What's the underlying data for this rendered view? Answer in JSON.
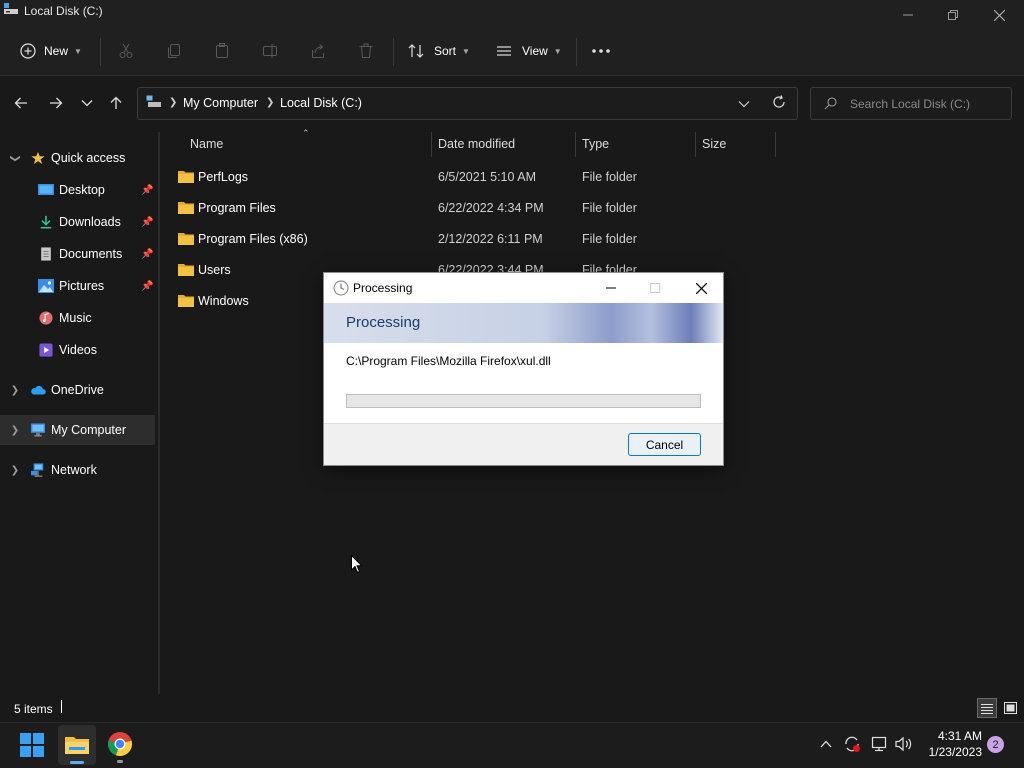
{
  "window": {
    "title": "Local Disk (C:)"
  },
  "toolbar": {
    "new_label": "New",
    "sort_label": "Sort",
    "view_label": "View"
  },
  "breadcrumb": {
    "items": [
      "My Computer",
      "Local Disk (C:)"
    ]
  },
  "search": {
    "placeholder": "Search Local Disk (C:)"
  },
  "columns": {
    "name": "Name",
    "date": "Date modified",
    "type": "Type",
    "size": "Size"
  },
  "files": [
    {
      "name": "PerfLogs",
      "date": "6/5/2021 5:10 AM",
      "type": "File folder"
    },
    {
      "name": "Program Files",
      "date": "6/22/2022 4:34 PM",
      "type": "File folder"
    },
    {
      "name": "Program Files (x86)",
      "date": "2/12/2022 6:11 PM",
      "type": "File folder"
    },
    {
      "name": "Users",
      "date": "6/22/2022 3:44 PM",
      "type": "File folder"
    },
    {
      "name": "Windows",
      "date": "",
      "type": ""
    }
  ],
  "sidebar": {
    "quick_access": "Quick access",
    "items": [
      "Desktop",
      "Downloads",
      "Documents",
      "Pictures",
      "Music",
      "Videos"
    ],
    "onedrive": "OneDrive",
    "my_computer": "My Computer",
    "network": "Network"
  },
  "status": {
    "items_count": "5 items"
  },
  "dialog": {
    "title": "Processing",
    "heading": "Processing",
    "current_file": "C:\\Program Files\\Mozilla Firefox\\xul.dll",
    "progress_fraction": 0.0,
    "cancel_label": "Cancel"
  },
  "taskbar": {
    "time": "4:31 AM",
    "date": "1/23/2023",
    "notification_count": "2"
  },
  "colors": {
    "accent": "#0078d4",
    "folder": "#f3c041",
    "progress": "#06b025",
    "notification_badge": "#c9a3e6"
  }
}
